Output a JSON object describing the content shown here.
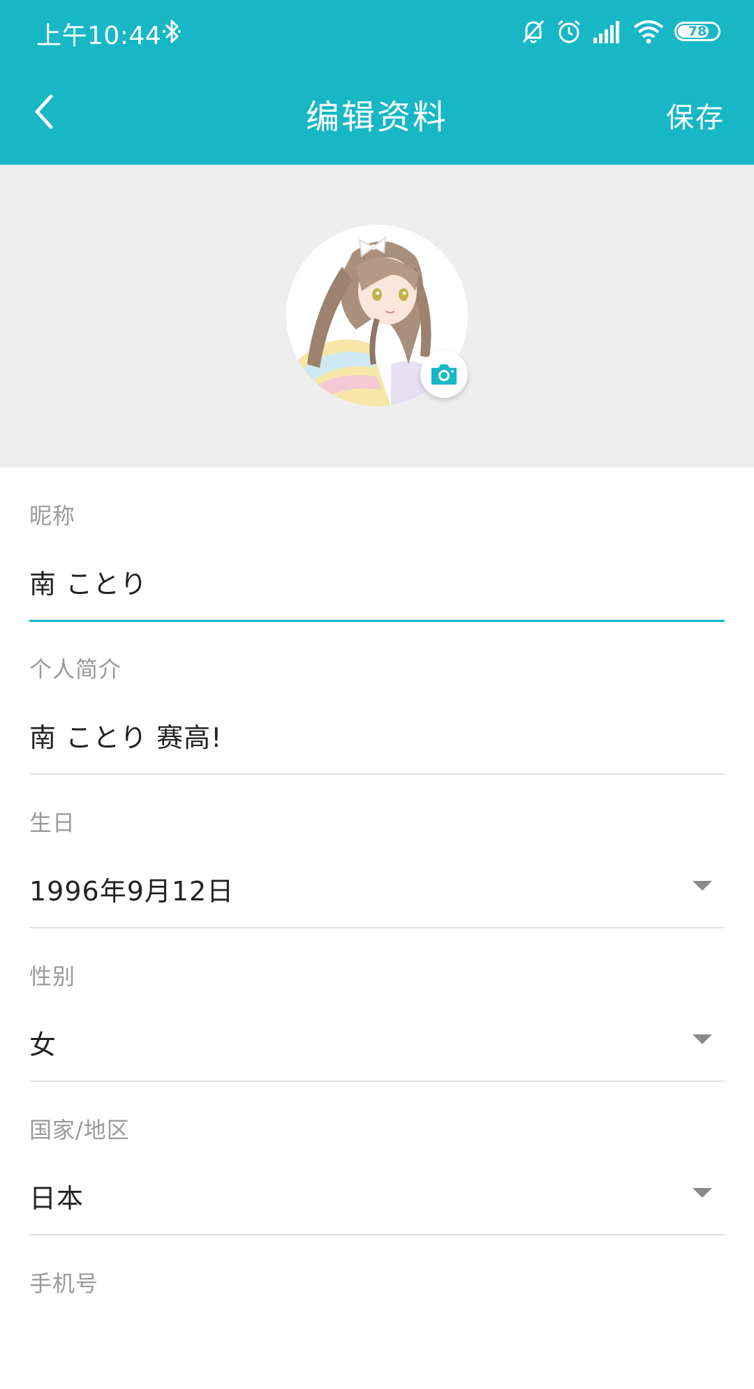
{
  "status_bar": {
    "time": "上午10:44",
    "battery_level": 78,
    "battery_text": "78",
    "icons": [
      "bluetooth-icon",
      "bell-off-icon",
      "alarm-icon",
      "signal-icon",
      "wifi-icon",
      "battery-icon"
    ]
  },
  "nav": {
    "title": "编辑资料",
    "save_label": "保存",
    "back_icon": "chevron-left-icon"
  },
  "avatar": {
    "camera_icon": "camera-icon"
  },
  "fields": [
    {
      "label": "昵称",
      "value": "南 ことり",
      "active": true
    },
    {
      "label": "个人简介",
      "value": "南 ことり 赛高!",
      "active": false
    },
    {
      "label": "生日",
      "value": "1996年9月12日",
      "dropdown": true
    },
    {
      "label": "性别",
      "value": "女",
      "dropdown": true
    },
    {
      "label": "国家/地区",
      "value": "日本",
      "dropdown": true
    },
    {
      "label": "手机号",
      "value": ""
    }
  ],
  "colors": {
    "accent": "#17b7c6",
    "background_gray": "#eeeeee",
    "label_gray": "#9a9a9a",
    "text": "#222222"
  }
}
